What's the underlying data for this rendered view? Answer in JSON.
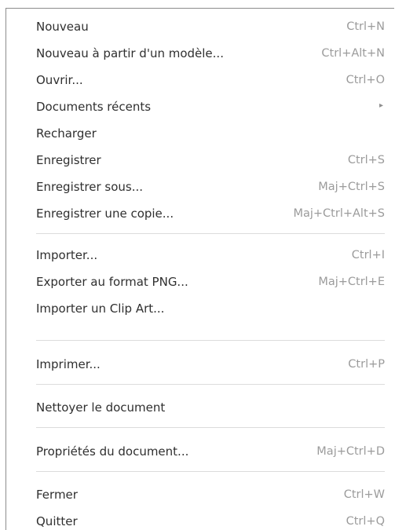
{
  "menu": {
    "items": [
      {
        "label": "Nouveau",
        "shortcut": "Ctrl+N"
      },
      {
        "label": "Nouveau à partir d'un modèle...",
        "shortcut": "Ctrl+Alt+N"
      },
      {
        "label": "Ouvrir...",
        "shortcut": "Ctrl+O"
      },
      {
        "label": "Documents récents",
        "submenu_icon": "▸"
      },
      {
        "label": "Recharger",
        "shortcut": ""
      },
      {
        "label": "Enregistrer",
        "shortcut": "Ctrl+S"
      },
      {
        "label": "Enregistrer sous...",
        "shortcut": "Maj+Ctrl+S"
      },
      {
        "label": "Enregistrer une copie...",
        "shortcut": "Maj+Ctrl+Alt+S"
      },
      {
        "label": "Importer...",
        "shortcut": "Ctrl+I"
      },
      {
        "label": "Exporter au format PNG...",
        "shortcut": "Maj+Ctrl+E"
      },
      {
        "label": "Importer un Clip Art...",
        "shortcut": ""
      },
      {
        "label": "Imprimer...",
        "shortcut": "Ctrl+P"
      },
      {
        "label": "Nettoyer le document",
        "shortcut": ""
      },
      {
        "label": "Propriétés du document...",
        "shortcut": "Maj+Ctrl+D"
      },
      {
        "label": "Fermer",
        "shortcut": "Ctrl+W"
      },
      {
        "label": "Quitter",
        "shortcut": "Ctrl+Q"
      }
    ]
  },
  "colors": {
    "text": "#2f2f2f",
    "shortcut_text": "#9b9b9b",
    "separator": "#dcdcdc",
    "border": "#8c8c8c"
  },
  "icons": {
    "submenu": "submenu-arrow-icon"
  }
}
